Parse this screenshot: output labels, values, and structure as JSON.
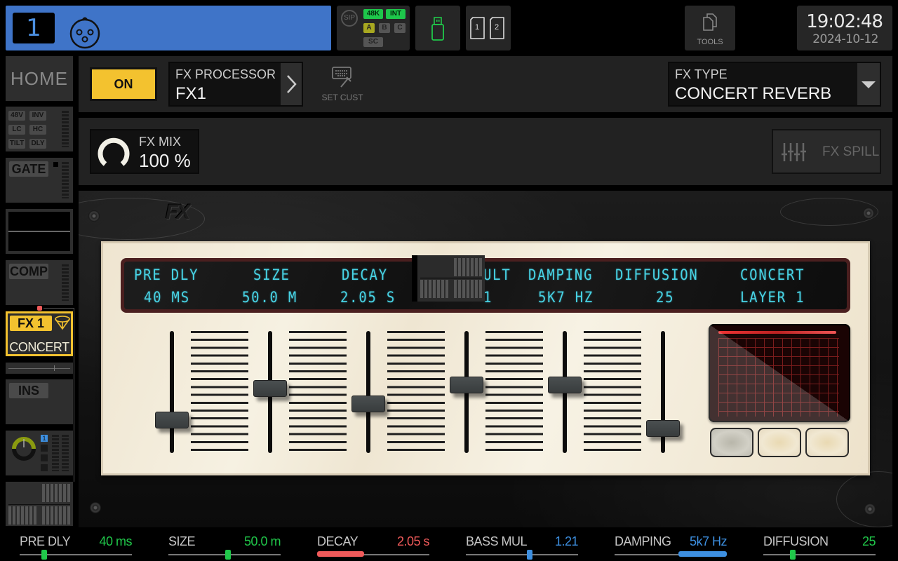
{
  "top_bar": {
    "channel_number": "1",
    "channel_input_icon": "xlr-connector-icon",
    "channel_color": "#3f74c8",
    "sync": {
      "sip_label": "SIP",
      "rate_label": "48K",
      "clock_label": "INT",
      "bank_a": "A",
      "bank_b": "B",
      "bank_c": "C",
      "sc_label": "SC"
    },
    "usb_icon": "usb-drive-icon",
    "cards": [
      "1",
      "2"
    ],
    "tools_label": "TOOLS",
    "clock_time": "19:02:48",
    "clock_date": "2024-10-12"
  },
  "sidebar": {
    "home_label": "HOME",
    "preamp_tags": [
      "48V",
      "INV",
      "LC",
      "HC",
      "TILT",
      "DLY"
    ],
    "gate_label": "GATE",
    "comp_label": "COMP",
    "fx_tag": "FX 1",
    "fx_name": "CONCERT",
    "ins_label": "INS",
    "send_number": "1"
  },
  "header": {
    "on_label": "ON",
    "fx_processor_label": "FX PROCESSOR",
    "fx_processor_value": "FX1",
    "set_cust_label": "SET CUST",
    "fx_type_label": "FX TYPE",
    "fx_type_value": "CONCERT REVERB",
    "fx_mix_label": "FX MIX",
    "fx_mix_value": "100 %",
    "fx_spill_label": "FX SPILL"
  },
  "fx_panel": {
    "logo": "FX",
    "lcd_row1": [
      "PRE DLY",
      "SIZE",
      "DECAY",
      "ULT",
      "DAMPING",
      "DIFFUSION",
      "CONCERT"
    ],
    "lcd_row2": [
      "40 MS",
      "50.0 M",
      "2.05 S",
      "1",
      "5K7 HZ",
      "25",
      "LAYER 1"
    ],
    "faders": [
      {
        "name": "pre-dly",
        "level": 0.27
      },
      {
        "name": "size",
        "level": 0.53
      },
      {
        "name": "decay",
        "level": 0.4
      },
      {
        "name": "bass-mul",
        "level": 0.56
      },
      {
        "name": "damping",
        "level": 0.56
      },
      {
        "name": "diffusion",
        "level": 0.2
      }
    ],
    "presets": 3
  },
  "params": [
    {
      "label": "PRE DLY",
      "value": "40 ms",
      "color": "#20c84a",
      "style": "thumb",
      "position": 0.22
    },
    {
      "label": "SIZE",
      "value": "50.0 m",
      "color": "#20c84a",
      "style": "thumb",
      "position": 0.53
    },
    {
      "label": "DECAY",
      "value": "2.05 s",
      "color": "#f05a5a",
      "style": "fill",
      "position": 0.42
    },
    {
      "label": "BASS MUL",
      "value": "1.21",
      "color": "#3d8fe0",
      "style": "thumb",
      "position": 0.57
    },
    {
      "label": "DAMPING",
      "value": "5k7 Hz",
      "color": "#3d8fe0",
      "style": "fill-right",
      "position": 0.57
    },
    {
      "label": "DIFFUSION",
      "value": "25",
      "color": "#20c84a",
      "style": "thumb",
      "position": 0.26
    }
  ]
}
